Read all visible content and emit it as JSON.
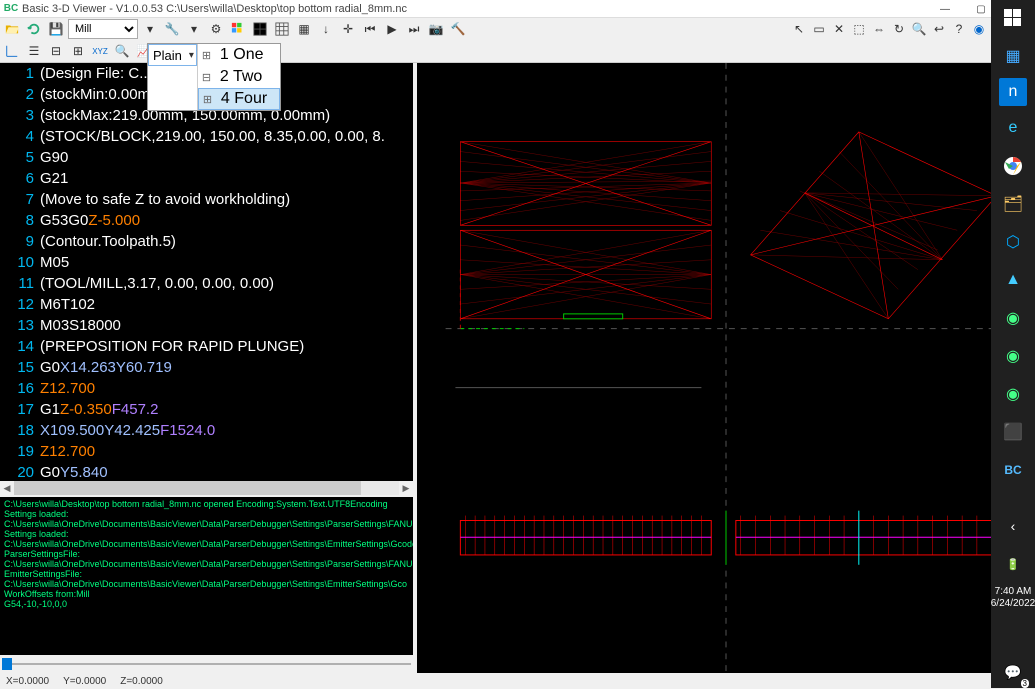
{
  "window": {
    "app_icon": "BC",
    "title": "Basic 3-D Viewer - V1.0.0.53    C:\\Users\\willa\\Desktop\\top bottom radial_8mm.nc",
    "min": "—",
    "max": "▢",
    "close": "✕"
  },
  "toolbar": {
    "machine_select": "Mill",
    "view_select": "Plain"
  },
  "dropdown": {
    "selected": "Plain",
    "options": [
      {
        "icon": "⊞",
        "label": "1 One"
      },
      {
        "icon": "⊟",
        "label": "2 Two"
      },
      {
        "icon": "⊞",
        "label": "4 Four"
      }
    ],
    "highlight_index": 2
  },
  "code": [
    {
      "n": 1,
      "raw": "(Design File: C..Users                        Design.into.3"
    },
    {
      "n": 2,
      "raw": "(stockMin:0.00mm, 0                  mm)"
    },
    {
      "n": 3,
      "raw": "(stockMax:219.00mm, 150.00mm, 0.00mm)"
    },
    {
      "n": 4,
      "raw": "(STOCK/BLOCK,219.00, 150.00, 8.35,0.00, 0.00, 8."
    },
    {
      "n": 5,
      "raw": "G90"
    },
    {
      "n": 6,
      "raw": "G21"
    },
    {
      "n": 7,
      "raw": "(Move to safe Z to avoid workholding)"
    },
    {
      "n": 8,
      "raw": "G53G0Z-5.000",
      "z": "Z-5.000"
    },
    {
      "n": 9,
      "raw": "(Contour.Toolpath.5)"
    },
    {
      "n": 10,
      "raw": "M05"
    },
    {
      "n": 11,
      "raw": "(TOOL/MILL,3.17, 0.00, 0.00, 0.00)"
    },
    {
      "n": 12,
      "raw": "M6T102"
    },
    {
      "n": 13,
      "raw": "M03S18000"
    },
    {
      "n": 14,
      "raw": "(PREPOSITION FOR RAPID PLUNGE)"
    },
    {
      "n": 15,
      "raw": "G0X14.263Y60.719",
      "x": "X14.263Y60.719"
    },
    {
      "n": 16,
      "raw": "Z12.700",
      "z": "Z12.700"
    },
    {
      "n": 17,
      "raw": "G1Z-0.350F457.2",
      "z": "Z-0.350",
      "f": "F457.2"
    },
    {
      "n": 18,
      "raw": "X109.500Y42.425F1524.0",
      "x": "X109.500Y42.425",
      "f": "F1524.0"
    },
    {
      "n": 19,
      "raw": "Z12.700",
      "z": "Z12.700"
    },
    {
      "n": 20,
      "raw": "G0Y5.840",
      "x": "Y5.840"
    }
  ],
  "log": [
    "C:\\Users\\willa\\Desktop\\top bottom radial_8mm.nc opened Encoding:System.Text.UTF8Encoding",
    "Settings loaded: C:\\Users\\willa\\OneDrive\\Documents\\BasicViewer\\Data\\ParserDebugger\\Settings\\ParserSettings\\FANUC_I",
    "Settings loaded: C:\\Users\\willa\\OneDrive\\Documents\\BasicViewer\\Data\\ParserDebugger\\Settings\\EmitterSettings\\GcodeE",
    "ParserSettingsFile: C:\\Users\\willa\\OneDrive\\Documents\\BasicViewer\\Data\\ParserDebugger\\Settings\\ParserSettings\\FANUC",
    "EmitterSettingsFile: C:\\Users\\willa\\OneDrive\\Documents\\BasicViewer\\Data\\ParserDebugger\\Settings\\EmitterSettings\\Gco",
    "WorkOffsets from:Mill",
    "G54,-10,-10,0,0"
  ],
  "status": {
    "x": "X=0.0000",
    "y": "Y=0.0000",
    "z": "Z=0.0000"
  },
  "taskbar": {
    "time": "7:40 AM",
    "date": "6/24/2022",
    "badge": "3"
  }
}
